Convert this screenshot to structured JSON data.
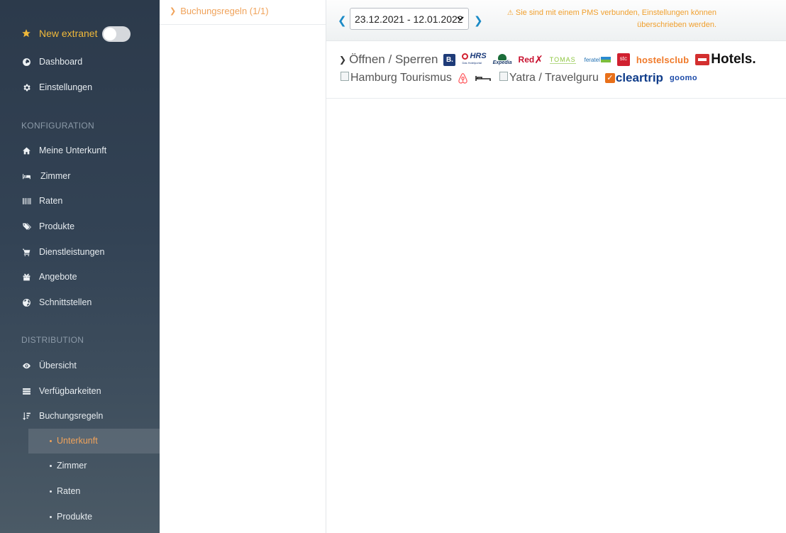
{
  "sidebar": {
    "extranet_label": "New extranet",
    "nav_top": [
      {
        "label": "Dashboard",
        "icon": "dashboard-icon"
      },
      {
        "label": "Einstellungen",
        "icon": "gear-icon"
      }
    ],
    "section_konfiguration": "KONFIGURATION",
    "konfiguration": [
      {
        "label": "Meine Unterkunft",
        "icon": "home-icon"
      },
      {
        "label": "Zimmer",
        "icon": "bed-icon"
      },
      {
        "label": "Raten",
        "icon": "barcode-icon"
      },
      {
        "label": "Produkte",
        "icon": "tags-icon"
      },
      {
        "label": "Dienstleistungen",
        "icon": "cart-icon"
      },
      {
        "label": "Angebote",
        "icon": "gift-icon"
      },
      {
        "label": "Schnittstellen",
        "icon": "globe-icon"
      }
    ],
    "section_distribution": "DISTRIBUTION",
    "distribution": [
      {
        "label": "Übersicht",
        "icon": "eye-icon"
      },
      {
        "label": "Verfügbarkeiten",
        "icon": "list-icon"
      },
      {
        "label": "Buchungsregeln",
        "icon": "sort-icon"
      }
    ],
    "buchungsregeln_sub": [
      {
        "label": "Unterkunft",
        "active": true
      },
      {
        "label": "Zimmer",
        "active": false
      },
      {
        "label": "Raten",
        "active": false
      },
      {
        "label": "Produkte",
        "active": false
      }
    ]
  },
  "middle": {
    "header": "Buchungsregeln (1/1)"
  },
  "toolbar": {
    "date_range": "23.12.2021 - 12.01.2022",
    "warning": "Sie sind mit einem PMS verbunden, Einstellungen können überschrieben werden."
  },
  "channels": {
    "toggle_label": "Öffnen / Sperren",
    "logos": {
      "booking": "B.",
      "hrs": "HRS",
      "hrs_sub": "Das Hotelportal",
      "expedia": "Expedia",
      "redx": "Red",
      "tomas": "TOMAS",
      "feratel": "feratel",
      "stc": "stc",
      "hostelsclub": "hostelsclub",
      "hotels": "Hotels."
    },
    "broken_hamburg": "Hamburg Tourismus",
    "broken_yatra": "Yatra / Travelguru",
    "cleartrip": "cleartrip",
    "goomo": "goomo"
  },
  "colors": {
    "accent_orange": "#f0a35b",
    "link_blue": "#1a8ac6",
    "warning": "#f0a02f",
    "sidebar_top": "#2c3a4b"
  }
}
